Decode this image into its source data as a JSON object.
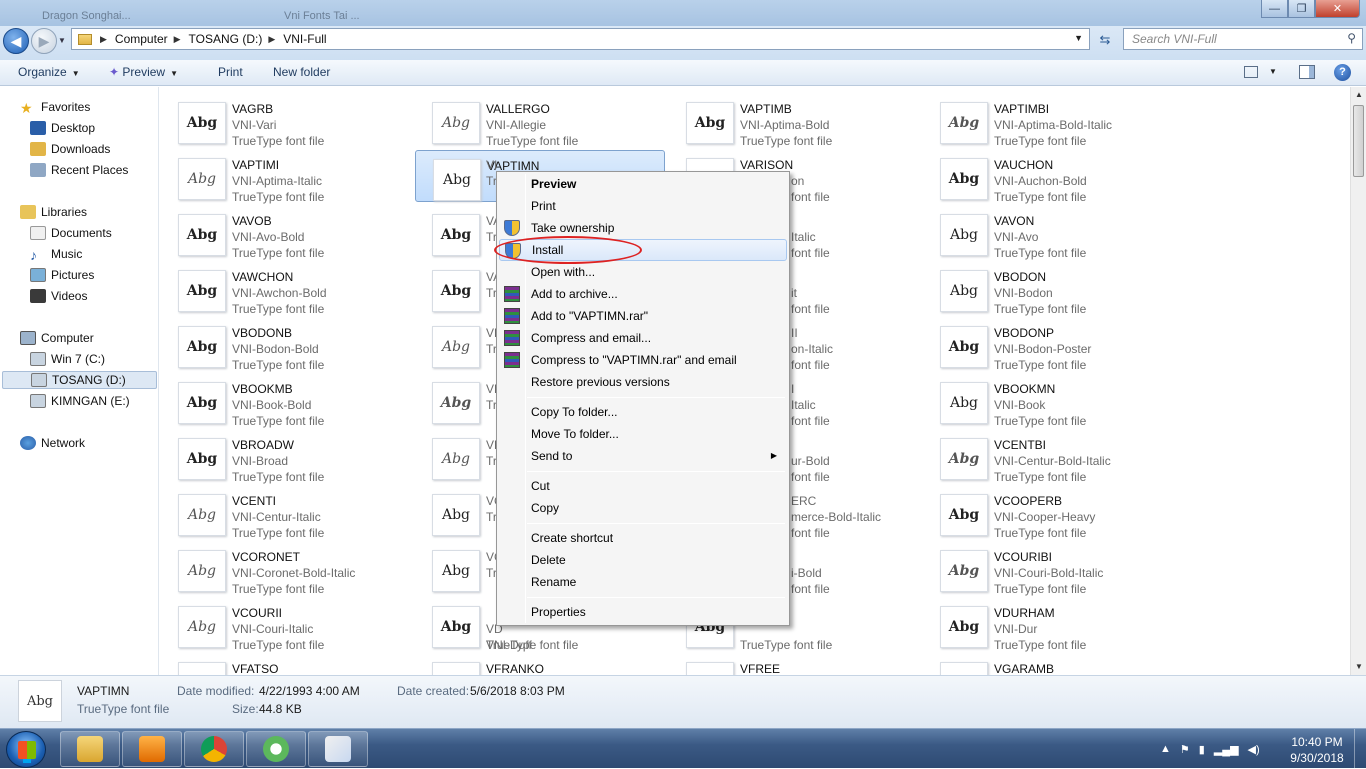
{
  "window": {
    "ghost_tab1": "Dragon Songhai...",
    "ghost_tab2": "Vni Fonts Tai ...",
    "min": "—",
    "max": "❐",
    "close": "✕"
  },
  "address": {
    "path": [
      "Computer",
      "TOSANG (D:)",
      "VNI-Full"
    ],
    "search_placeholder": "Search VNI-Full"
  },
  "toolbar": {
    "organize": "Organize",
    "preview": "Preview",
    "print": "Print",
    "new_folder": "New folder"
  },
  "nav": {
    "favorites": "Favorites",
    "desktop": "Desktop",
    "downloads": "Downloads",
    "recent": "Recent Places",
    "libraries": "Libraries",
    "documents": "Documents",
    "music": "Music",
    "pictures": "Pictures",
    "videos": "Videos",
    "computer": "Computer",
    "win7": "Win 7 (C:)",
    "tosang": "TOSANG (D:)",
    "kimngan": "KIMNGAN (E:)",
    "network": "Network"
  },
  "files": [
    {
      "name": "VAGRB",
      "sub": "VNI-Vari",
      "type": "TrueType font file",
      "style": "bd"
    },
    {
      "name": "VALLERGO",
      "sub": "VNI-Allegie",
      "type": "TrueType font file",
      "style": "it"
    },
    {
      "name": "VAPTIMB",
      "sub": "VNI-Aptima-Bold",
      "type": "TrueType font file",
      "style": "bd"
    },
    {
      "name": "VAPTIMBI",
      "sub": "VNI-Aptima-Bold-Italic",
      "type": "TrueType font file",
      "style": "bd it"
    },
    {
      "name": "VAPTIMI",
      "sub": "VNI-Aptima-Italic",
      "type": "TrueType font file",
      "style": "it"
    },
    {
      "name": "VAPTIMN",
      "sub": "",
      "type": "",
      "style": ""
    },
    {
      "name": "VARISON",
      "sub": "",
      "type": "",
      "style": ""
    },
    {
      "name": "VAUCHON",
      "sub": "VNI-Auchon-Bold",
      "type": "TrueType font file",
      "style": "bd"
    },
    {
      "name": "VAVOB",
      "sub": "VNI-Avo-Bold",
      "type": "TrueType font file",
      "style": "bd"
    },
    {
      "name": "",
      "sub": "",
      "type": "",
      "style": "bd"
    },
    {
      "name": "",
      "sub": "",
      "type": "",
      "style": ""
    },
    {
      "name": "VAVON",
      "sub": "VNI-Avo",
      "type": "TrueType font file",
      "style": ""
    },
    {
      "name": "VAWCHON",
      "sub": "VNI-Awchon-Bold",
      "type": "TrueType font file",
      "style": "bd"
    },
    {
      "name": "",
      "sub": "",
      "type": "",
      "style": "bd"
    },
    {
      "name": "",
      "sub": "",
      "type": "",
      "style": ""
    },
    {
      "name": "VBODON",
      "sub": "VNI-Bodon",
      "type": "TrueType font file",
      "style": ""
    },
    {
      "name": "VBODONB",
      "sub": "VNI-Bodon-Bold",
      "type": "TrueType font file",
      "style": "bd"
    },
    {
      "name": "",
      "sub": "",
      "type": "",
      "style": "it"
    },
    {
      "name": "",
      "sub": "",
      "type": "",
      "style": ""
    },
    {
      "name": "VBODONP",
      "sub": "VNI-Bodon-Poster",
      "type": "TrueType font file",
      "style": "bd"
    },
    {
      "name": "VBOOKMB",
      "sub": "VNI-Book-Bold",
      "type": "TrueType font file",
      "style": "bd"
    },
    {
      "name": "",
      "sub": "",
      "type": "",
      "style": "bd it"
    },
    {
      "name": "",
      "sub": "",
      "type": "",
      "style": ""
    },
    {
      "name": "VBOOKMN",
      "sub": "VNI-Book",
      "type": "TrueType font file",
      "style": ""
    },
    {
      "name": "VBROADW",
      "sub": "VNI-Broad",
      "type": "TrueType font file",
      "style": "bd"
    },
    {
      "name": "",
      "sub": "",
      "type": "",
      "style": "it"
    },
    {
      "name": "",
      "sub": "",
      "type": "",
      "style": ""
    },
    {
      "name": "VCENTBI",
      "sub": "VNI-Centur-Bold-Italic",
      "type": "TrueType font file",
      "style": "bd it"
    },
    {
      "name": "VCENTI",
      "sub": "VNI-Centur-Italic",
      "type": "TrueType font file",
      "style": "it"
    },
    {
      "name": "",
      "sub": "",
      "type": "",
      "style": ""
    },
    {
      "name": "",
      "sub": "",
      "type": "",
      "style": ""
    },
    {
      "name": "VCOOPERB",
      "sub": "VNI-Cooper-Heavy",
      "type": "TrueType font file",
      "style": "bd"
    },
    {
      "name": "VCORONET",
      "sub": "VNI-Coronet-Bold-Italic",
      "type": "TrueType font file",
      "style": "it"
    },
    {
      "name": "",
      "sub": "",
      "type": "",
      "style": ""
    },
    {
      "name": "",
      "sub": "",
      "type": "",
      "style": ""
    },
    {
      "name": "VCOURIBI",
      "sub": "VNI-Couri-Bold-Italic",
      "type": "TrueType font file",
      "style": "bd it"
    },
    {
      "name": "VCOURII",
      "sub": "VNI-Couri-Italic",
      "type": "TrueType font file",
      "style": "it"
    },
    {
      "name": "",
      "sub": "",
      "type": "TrueType font file",
      "style": "bd"
    },
    {
      "name": "",
      "sub": "",
      "type": "TrueType font file",
      "style": "bd"
    },
    {
      "name": "VDURHAM",
      "sub": "VNI-Dur",
      "type": "TrueType font file",
      "style": "bd"
    },
    {
      "name": "VFATSO",
      "sub": "",
      "type": "",
      "style": ""
    },
    {
      "name": "VFRANKO",
      "sub": "",
      "type": "",
      "style": ""
    },
    {
      "name": "VFREE",
      "sub": "",
      "type": "",
      "style": ""
    },
    {
      "name": "VGARAMB",
      "sub": "",
      "type": "",
      "style": ""
    }
  ],
  "partials": {
    "c2r1": "on",
    "c2r1b": "font file",
    "c2r2": "Italic",
    "c2r2b": "font file",
    "c2r3": "it",
    "c2r3b": "font file",
    "c2r4": "II",
    "c2r4b": "on-Italic",
    "c2r4c": "font file",
    "c2r5": "I",
    "c2r5b": "Italic",
    "c2r5c": "font file",
    "c2r6": "ur-Bold",
    "c2r6b": "font file",
    "c2r7": "ERC",
    "c2r7b": "merce-Bold-Italic",
    "c2r7c": "font file",
    "c2r8": "i-Bold",
    "c2r8b": "font file",
    "c1r1": "VI",
    "c1r1b": "Tr",
    "c1r2": "VA",
    "c1r2b": "Tr",
    "c1r3": "VA",
    "c1r3b": "Tr",
    "c1r4": "VE",
    "c1r4b": "Tr",
    "c1r5": "VE",
    "c1r5b": "Tr",
    "c1r6": "VE",
    "c1r6b": "Tr",
    "c1r7": "VC",
    "c1r7b": "Tr",
    "c1r8": "VC",
    "c1r8b": "Tr",
    "c1r9": "VD",
    "c1r9b": "VNI-Duff"
  },
  "context_menu": {
    "preview": "Preview",
    "print": "Print",
    "take_ownership": "Take ownership",
    "install": "Install",
    "open_with": "Open with...",
    "add_archive": "Add to archive...",
    "add_rar": "Add to \"VAPTIMN.rar\"",
    "compress_email": "Compress and email...",
    "compress_rar_email": "Compress to \"VAPTIMN.rar\" and email",
    "restore": "Restore previous versions",
    "copy_to": "Copy To folder...",
    "move_to": "Move To folder...",
    "send_to": "Send to",
    "cut": "Cut",
    "copy": "Copy",
    "create_shortcut": "Create shortcut",
    "delete": "Delete",
    "rename": "Rename",
    "properties": "Properties"
  },
  "details": {
    "name": "VAPTIMN",
    "type": "TrueType font file",
    "modified_label": "Date modified:",
    "modified": "4/22/1993 4:00 AM",
    "created_label": "Date created:",
    "created": "5/6/2018 8:03 PM",
    "size_label": "Size:",
    "size": "44.8 KB",
    "thumb": "Abg"
  },
  "thumb_text": "Abg",
  "clock": {
    "time": "10:40 PM",
    "date": "9/30/2018"
  }
}
